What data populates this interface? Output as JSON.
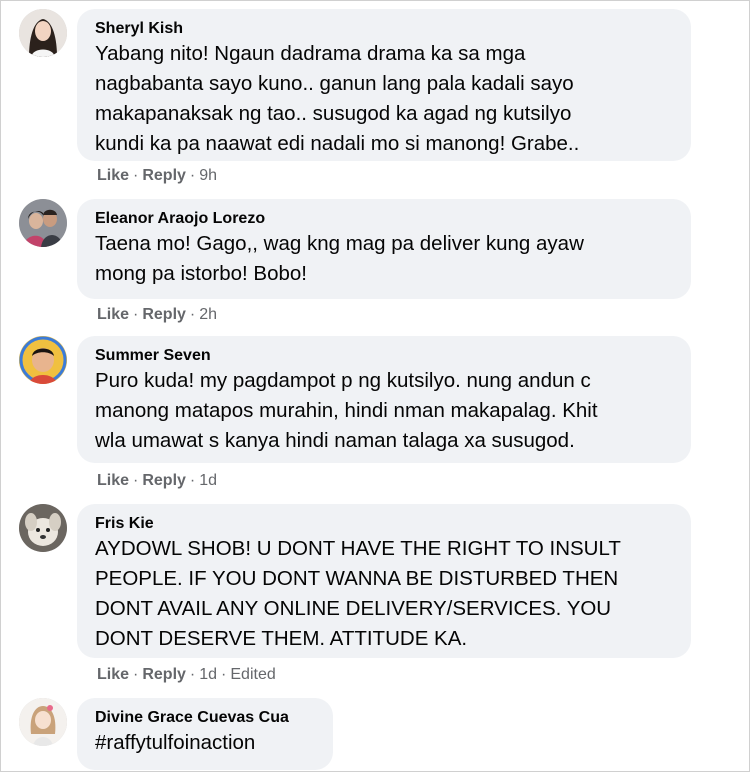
{
  "actions": {
    "like": "Like",
    "reply": "Reply",
    "separator": "·"
  },
  "comments": [
    {
      "author": "Sheryl Kish",
      "avatar_icon": "profile-photo-woman-icon",
      "lines": [
        "Yabang nito! Ngaun dadrama drama ka sa mga",
        "nagbabanta sayo kuno.. ganun lang pala kadali sayo",
        "makapanaksak ng tao.. susugod ka agad ng kutsilyo",
        "kundi ka pa naawat edi nadali mo si manong! Grabe.."
      ],
      "time": "9h"
    },
    {
      "author": "Eleanor Araojo Lorezo",
      "avatar_icon": "profile-photo-couple-icon",
      "lines": [
        "Taena mo! Gago,, wag kng mag pa deliver kung ayaw",
        "mong pa istorbo! Bobo!"
      ],
      "time": "2h"
    },
    {
      "author": "Summer Seven",
      "avatar_icon": "profile-photo-child-icon",
      "lines": [
        "Puro kuda! my pagdampot p ng kutsilyo. nung andun c",
        "manong matapos murahin, hindi nman makapalag. Khit",
        "wla umawat s kanya hindi naman talaga xa susugod."
      ],
      "time": "1d"
    },
    {
      "author": "Fris Kie",
      "avatar_icon": "profile-photo-dog-icon",
      "lines": [
        "AYDOWL SHOB! U DONT HAVE THE RIGHT TO INSULT",
        "PEOPLE. IF YOU DONT WANNA BE DISTURBED THEN",
        "DONT AVAIL ANY ONLINE DELIVERY/SERVICES. YOU",
        "DONT DESERVE THEM. ATTITUDE KA."
      ],
      "time": "1d",
      "edited": "Edited"
    },
    {
      "author": "Divine Grace Cuevas Cua",
      "avatar_icon": "profile-photo-illustration-icon",
      "lines": [
        "#raffytulfoinaction"
      ]
    }
  ],
  "colors": {
    "bubble": "#f0f2f5",
    "text": "#050505",
    "meta": "#65676b"
  }
}
